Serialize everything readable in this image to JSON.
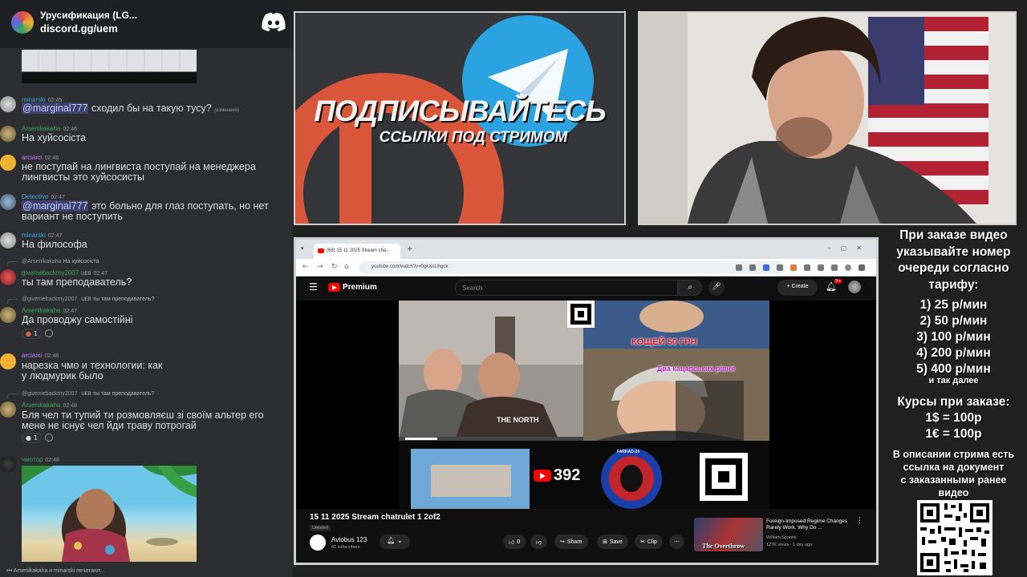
{
  "discord": {
    "server_name": "Урусификация (LG...",
    "invite": "discord.gg/uem",
    "messages": [
      {
        "user": "minarski",
        "time": "02:45",
        "mention": "@marginal777",
        "text": " сходил бы на такую тусу?",
        "edited": "(изменено)"
      },
      {
        "user": "Arsenikakaha",
        "time": "02:46",
        "text": "На хуйсосіста"
      },
      {
        "user": "arciarci",
        "time": "02:46",
        "text": "не поступай на лингвиста поступай на менеджера лингвисты это хуйсосисты"
      },
      {
        "user": "Detective",
        "time": "02:47",
        "mention": "@marginal777",
        "text": " это больно для глаз поступать, но нет вариант не поступить"
      },
      {
        "user": "minarski",
        "time": "02:47",
        "text": "На философа"
      },
      {
        "reply_user": "@Arsenikakaha",
        "reply_text": "На хуйсосіста",
        "user": "givemebackmy2007",
        "badge": "UEB",
        "time": "02:47",
        "text": "ты там преподаватель?"
      },
      {
        "reply_user": "@givemebackmy2007",
        "reply_badge": "UEB",
        "reply_text": "ты там преподаватель?",
        "user": "Arsenikakaha",
        "time": "02:47",
        "text": "Да проводжу самостійні",
        "reaction_count": "1"
      },
      {
        "user": "arciarci",
        "time": "02:48",
        "text": "нарезка чмо и технологии: как у людмурик было"
      },
      {
        "reply_user": "@givemebackmy2007",
        "reply_badge": "UEB",
        "reply_text": "ты там преподаватель?",
        "user": "Arsenikakaha",
        "time": "02:48",
        "text": "Бля чел ти тупий ти розмовляєш зі своїм альтер его мене не існує чел йди траву потрогай",
        "reaction_count": "1"
      },
      {
        "user": "чмотор",
        "time": "02:48",
        "text": ""
      }
    ],
    "typing": "Arsenikakaha и minarski печатают..."
  },
  "promo": {
    "main": "ПОДПИСЫВАЙТЕСЬ",
    "sub": "ССЫЛКИ ПОД СТРИМОМ"
  },
  "browser": {
    "tab_title": "(68) 15 11 2025 Stream cha...",
    "url": "youtube.com/watch?v=0gkXoUhgck"
  },
  "youtube": {
    "brand": "Premium",
    "search_placeholder": "Search",
    "create": "Create",
    "notif_count": "9+",
    "video_title": "15 11 2025 Stream chatrulet 1 2of2",
    "visibility": "Unlisted",
    "channel": "Avtobus 123",
    "subs": "41 subscribers",
    "likes": "0",
    "share": "Share",
    "save": "Save",
    "clip": "Clip",
    "overlay_price": "КОЩЕЙ 50 ГРН",
    "overlay_sub": "Два кацапських рівня",
    "overlay_brand": "THE NORTH",
    "overlay_viewers": "392",
    "overlay_seal": "FARHAD-24",
    "suggest_title": "Foreign-Imposed Regime Changes Rarely Work. Why Do ...",
    "suggest_channel": "William Spaniel",
    "suggest_meta": "127K views · 1 day ago",
    "suggest_thumb_text": "The Overthrow"
  },
  "info": {
    "order_lines": [
      "При заказе видео",
      "указывайте номер",
      "очереди согласно",
      "тарифу:"
    ],
    "rates": [
      "1) 25 р/мин",
      "2) 50 р/мин",
      "3) 100 р/мин",
      "4) 200 р/мин",
      "5) 400 р/мин"
    ],
    "etc": "и так далее",
    "courses": [
      "Курсы при заказе:",
      "1$ = 100р",
      "1€ = 100р"
    ],
    "desc": [
      "В описании стрима есть",
      "ссылка на документ",
      "с заказанными ранее",
      "видео"
    ]
  },
  "colors": {
    "discord_bg": "#2b2d31",
    "mention_bg": "#3c4270",
    "youtube_red": "#ff0000",
    "telegram_blue": "#2aa3e0",
    "patreon_orange": "#e0573b"
  }
}
